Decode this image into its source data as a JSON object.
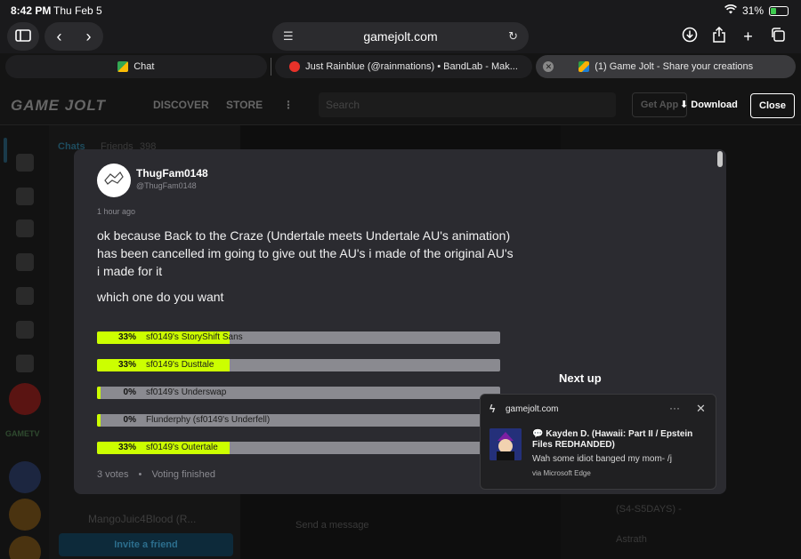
{
  "status": {
    "time": "8:42 PM",
    "date": "Thu Feb 5",
    "battery": "31%",
    "battery_level": 0.31
  },
  "browser": {
    "url": "gamejolt.com",
    "tabs": [
      {
        "label": "Chat",
        "active": false
      },
      {
        "label": "Just Rainblue (@rainmations) • BandLab - Mak...",
        "active": false
      },
      {
        "label": "(1) Game Jolt - Share your creations",
        "active": true
      }
    ]
  },
  "gamejolt": {
    "logo": "GAME JOLT",
    "nav": [
      "DISCOVER",
      "STORE"
    ],
    "search_placeholder": "Search",
    "get_app": "Get App",
    "download": "Download",
    "close": "Close",
    "chats_tab": "Chats",
    "friends_tab": "Friends",
    "friends_count": "398",
    "chat_item": "MangoJuic4Blood (R...",
    "invite": "Invite a friend",
    "send_placeholder": "Send a message",
    "side_list": [
      "(S4-S5DAYS) -",
      "Astrath"
    ],
    "logo_text_side": "GAMETV"
  },
  "post": {
    "author_name": "ThugFam0148",
    "author_handle": "@ThugFam0148",
    "time_ago": "1 hour ago",
    "body": "ok because Back to the Craze (Undertale meets Undertale AU's animation) has been cancelled im going to give out the AU's i made of the original AU's i made for it",
    "question": "which one do you want",
    "poll": [
      {
        "percent_label": "33%",
        "fraction": 0.33,
        "label": "sf0149's StoryShift Sans"
      },
      {
        "percent_label": "33%",
        "fraction": 0.33,
        "label": "sf0149's Dusttale"
      },
      {
        "percent_label": "0%",
        "fraction": 0.0,
        "label": "sf0149's Underswap"
      },
      {
        "percent_label": "0%",
        "fraction": 0.0,
        "label": "Flunderphy (sf0149's Underfell)"
      },
      {
        "percent_label": "33%",
        "fraction": 0.33,
        "label": "sf0149's Outertale"
      }
    ],
    "votes": "3 votes",
    "status": "Voting finished",
    "next_up": "Next up"
  },
  "notification": {
    "source": "gamejolt.com",
    "title": "Kayden D. (Hawaii: Part II / Epstein Files REDHANDED)",
    "message": "Wah some idiot banged my mom- /j",
    "via": "via Microsoft Edge"
  },
  "colors": {
    "poll_fill": "#ccff00",
    "poll_track": "#8a8a90",
    "modal_bg": "#2b2b30"
  }
}
